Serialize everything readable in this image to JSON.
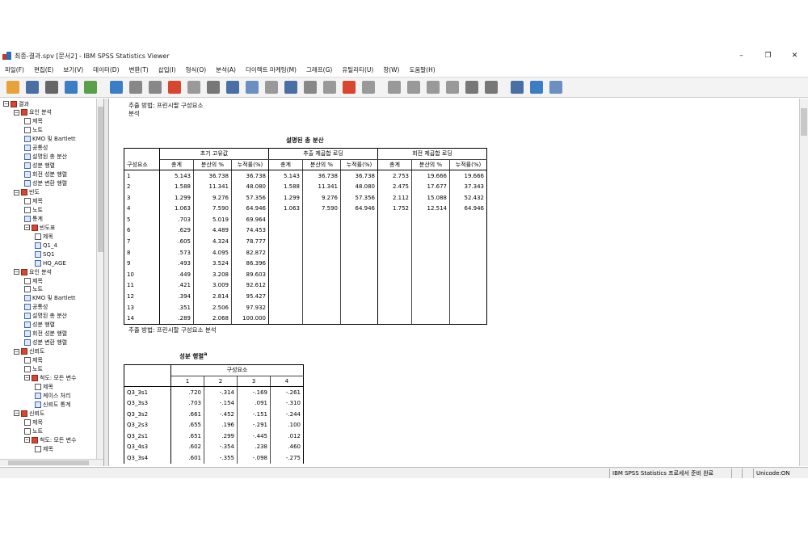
{
  "window": {
    "title": "최종-결과.spv [문서2] - IBM SPSS Statistics Viewer",
    "controls": [
      "–",
      "❐",
      "✕"
    ]
  },
  "menu": [
    "파일(F)",
    "편집(E)",
    "보기(V)",
    "데이터(D)",
    "변환(T)",
    "삽입(I)",
    "형식(O)",
    "분석(A)",
    "다이렉트 마케팅(M)",
    "그래프(G)",
    "유틸리티(U)",
    "창(W)",
    "도움말(H)"
  ],
  "colors": {
    "accent": "#2e6db4",
    "book": "#d9462f"
  },
  "nav": {
    "items": [
      {
        "label": "결과",
        "depth": 0,
        "icon": "book-icon",
        "toggle": "−"
      },
      {
        "label": "요인 분석",
        "depth": 1,
        "icon": "book-icon",
        "toggle": "−"
      },
      {
        "label": "제목",
        "depth": 2,
        "icon": "title-icon"
      },
      {
        "label": "노트",
        "depth": 2,
        "icon": "notes-icon"
      },
      {
        "label": "KMO 및 Bartlett",
        "depth": 2,
        "icon": "table-icon"
      },
      {
        "label": "공통성",
        "depth": 2,
        "icon": "table-icon"
      },
      {
        "label": "설명된 총 분산",
        "depth": 2,
        "icon": "table-icon"
      },
      {
        "label": "성분 행렬",
        "depth": 2,
        "icon": "table-icon"
      },
      {
        "label": "회전 성분 행렬",
        "depth": 2,
        "icon": "table-icon"
      },
      {
        "label": "성분 변환 행렬",
        "depth": 2,
        "icon": "table-icon"
      },
      {
        "label": "빈도",
        "depth": 1,
        "icon": "book-icon",
        "toggle": "−"
      },
      {
        "label": "제목",
        "depth": 2,
        "icon": "title-icon"
      },
      {
        "label": "노트",
        "depth": 2,
        "icon": "notes-icon"
      },
      {
        "label": "통계",
        "depth": 2,
        "icon": "table-icon"
      },
      {
        "label": "빈도표",
        "depth": 2,
        "icon": "book-icon",
        "toggle": "−"
      },
      {
        "label": "제목",
        "depth": 3,
        "icon": "title-icon"
      },
      {
        "label": "Q1_4",
        "depth": 3,
        "icon": "table-icon"
      },
      {
        "label": "SQ1",
        "depth": 3,
        "icon": "table-icon"
      },
      {
        "label": "HQ_AGE",
        "depth": 3,
        "icon": "table-icon"
      },
      {
        "label": "요인 분석",
        "depth": 1,
        "icon": "book-icon",
        "toggle": "−"
      },
      {
        "label": "제목",
        "depth": 2,
        "icon": "title-icon"
      },
      {
        "label": "노트",
        "depth": 2,
        "icon": "notes-icon"
      },
      {
        "label": "KMO 및 Bartlett",
        "depth": 2,
        "icon": "table-icon"
      },
      {
        "label": "공통성",
        "depth": 2,
        "icon": "table-icon"
      },
      {
        "label": "설명된 총 분산",
        "depth": 2,
        "icon": "table-icon"
      },
      {
        "label": "성분 행렬",
        "depth": 2,
        "icon": "table-icon"
      },
      {
        "label": "회전 성분 행렬",
        "depth": 2,
        "icon": "table-icon"
      },
      {
        "label": "성분 변환 행렬",
        "depth": 2,
        "icon": "table-icon"
      },
      {
        "label": "신뢰도",
        "depth": 1,
        "icon": "book-icon",
        "toggle": "−"
      },
      {
        "label": "제목",
        "depth": 2,
        "icon": "title-icon"
      },
      {
        "label": "노트",
        "depth": 2,
        "icon": "notes-icon"
      },
      {
        "label": "척도: 모든 변수",
        "depth": 2,
        "icon": "book-icon",
        "toggle": "−"
      },
      {
        "label": "제목",
        "depth": 3,
        "icon": "title-icon"
      },
      {
        "label": "케이스 처리",
        "depth": 3,
        "icon": "table-icon"
      },
      {
        "label": "신뢰도 통계",
        "depth": 3,
        "icon": "table-icon"
      },
      {
        "label": "신뢰도",
        "depth": 1,
        "icon": "book-icon",
        "toggle": "−"
      },
      {
        "label": "제목",
        "depth": 2,
        "icon": "title-icon"
      },
      {
        "label": "노트",
        "depth": 2,
        "icon": "notes-icon"
      },
      {
        "label": "척도: 모든 변수",
        "depth": 2,
        "icon": "book-icon",
        "toggle": "−"
      },
      {
        "label": "제목",
        "depth": 3,
        "icon": "title-icon"
      }
    ]
  },
  "output": {
    "notes_top": [
      "추출 방법: 프린시팔 구성요소",
      "분석"
    ],
    "variance_table": {
      "title": "설명된 총 분산",
      "group_headers": [
        "초기 고유값",
        "추출 제곱합 로딩",
        "회전 제곱합 로딩"
      ],
      "row_header": "구성요소",
      "sub_headers": [
        "총계",
        "분산의 %",
        "누적률(%)",
        "총계",
        "분산의 %",
        "누적률(%)",
        "총계",
        "분산의 %",
        "누적률(%)"
      ],
      "rows": [
        [
          "1",
          "5.143",
          "36.738",
          "36.738",
          "5.143",
          "36.738",
          "36.738",
          "2.753",
          "19.666",
          "19.666"
        ],
        [
          "2",
          "1.588",
          "11.341",
          "48.080",
          "1.588",
          "11.341",
          "48.080",
          "2.475",
          "17.677",
          "37.343"
        ],
        [
          "3",
          "1.299",
          "9.276",
          "57.356",
          "1.299",
          "9.276",
          "57.356",
          "2.112",
          "15.088",
          "52.432"
        ],
        [
          "4",
          "1.063",
          "7.590",
          "64.946",
          "1.063",
          "7.590",
          "64.946",
          "1.752",
          "12.514",
          "64.946"
        ],
        [
          "5",
          ".703",
          "5.019",
          "69.964",
          "",
          "",
          "",
          "",
          "",
          ""
        ],
        [
          "6",
          ".629",
          "4.489",
          "74.453",
          "",
          "",
          "",
          "",
          "",
          ""
        ],
        [
          "7",
          ".605",
          "4.324",
          "78.777",
          "",
          "",
          "",
          "",
          "",
          ""
        ],
        [
          "8",
          ".573",
          "4.095",
          "82.872",
          "",
          "",
          "",
          "",
          "",
          ""
        ],
        [
          "9",
          ".493",
          "3.524",
          "86.396",
          "",
          "",
          "",
          "",
          "",
          ""
        ],
        [
          "10",
          ".449",
          "3.208",
          "89.603",
          "",
          "",
          "",
          "",
          "",
          ""
        ],
        [
          "11",
          ".421",
          "3.009",
          "92.612",
          "",
          "",
          "",
          "",
          "",
          ""
        ],
        [
          "12",
          ".394",
          "2.814",
          "95.427",
          "",
          "",
          "",
          "",
          "",
          ""
        ],
        [
          "13",
          ".351",
          "2.506",
          "97.932",
          "",
          "",
          "",
          "",
          "",
          ""
        ],
        [
          "14",
          ".289",
          "2.068",
          "100.000",
          "",
          "",
          "",
          "",
          "",
          ""
        ]
      ],
      "footnote": "추출 방법: 프린시팔 구성요소 분석"
    },
    "component_table": {
      "title": "성분 행렬",
      "title_sup": "a",
      "group_header": "구성요소",
      "sub_headers": [
        "1",
        "2",
        "3",
        "4"
      ],
      "rows": [
        [
          "Q3_3s1",
          ".720",
          "-.314",
          "-.169",
          "-.261"
        ],
        [
          "Q3_3s3",
          ".703",
          "-.154",
          ".091",
          "-.310"
        ],
        [
          "Q3_3s2",
          ".661",
          "-.452",
          "-.151",
          "-.244"
        ],
        [
          "Q3_2s3",
          ".655",
          ".196",
          "-.291",
          ".100"
        ],
        [
          "Q3_2s1",
          ".651",
          ".299",
          "-.445",
          ".012"
        ],
        [
          "Q3_4s3",
          ".602",
          "-.354",
          ".238",
          ".460"
        ],
        [
          "Q3_3s4",
          ".601",
          "-.355",
          "-.098",
          "-.275"
        ]
      ]
    }
  },
  "status": {
    "processor": "IBM SPSS Statistics 프로세서 준비 완료",
    "encoding": "Unicode:ON"
  }
}
